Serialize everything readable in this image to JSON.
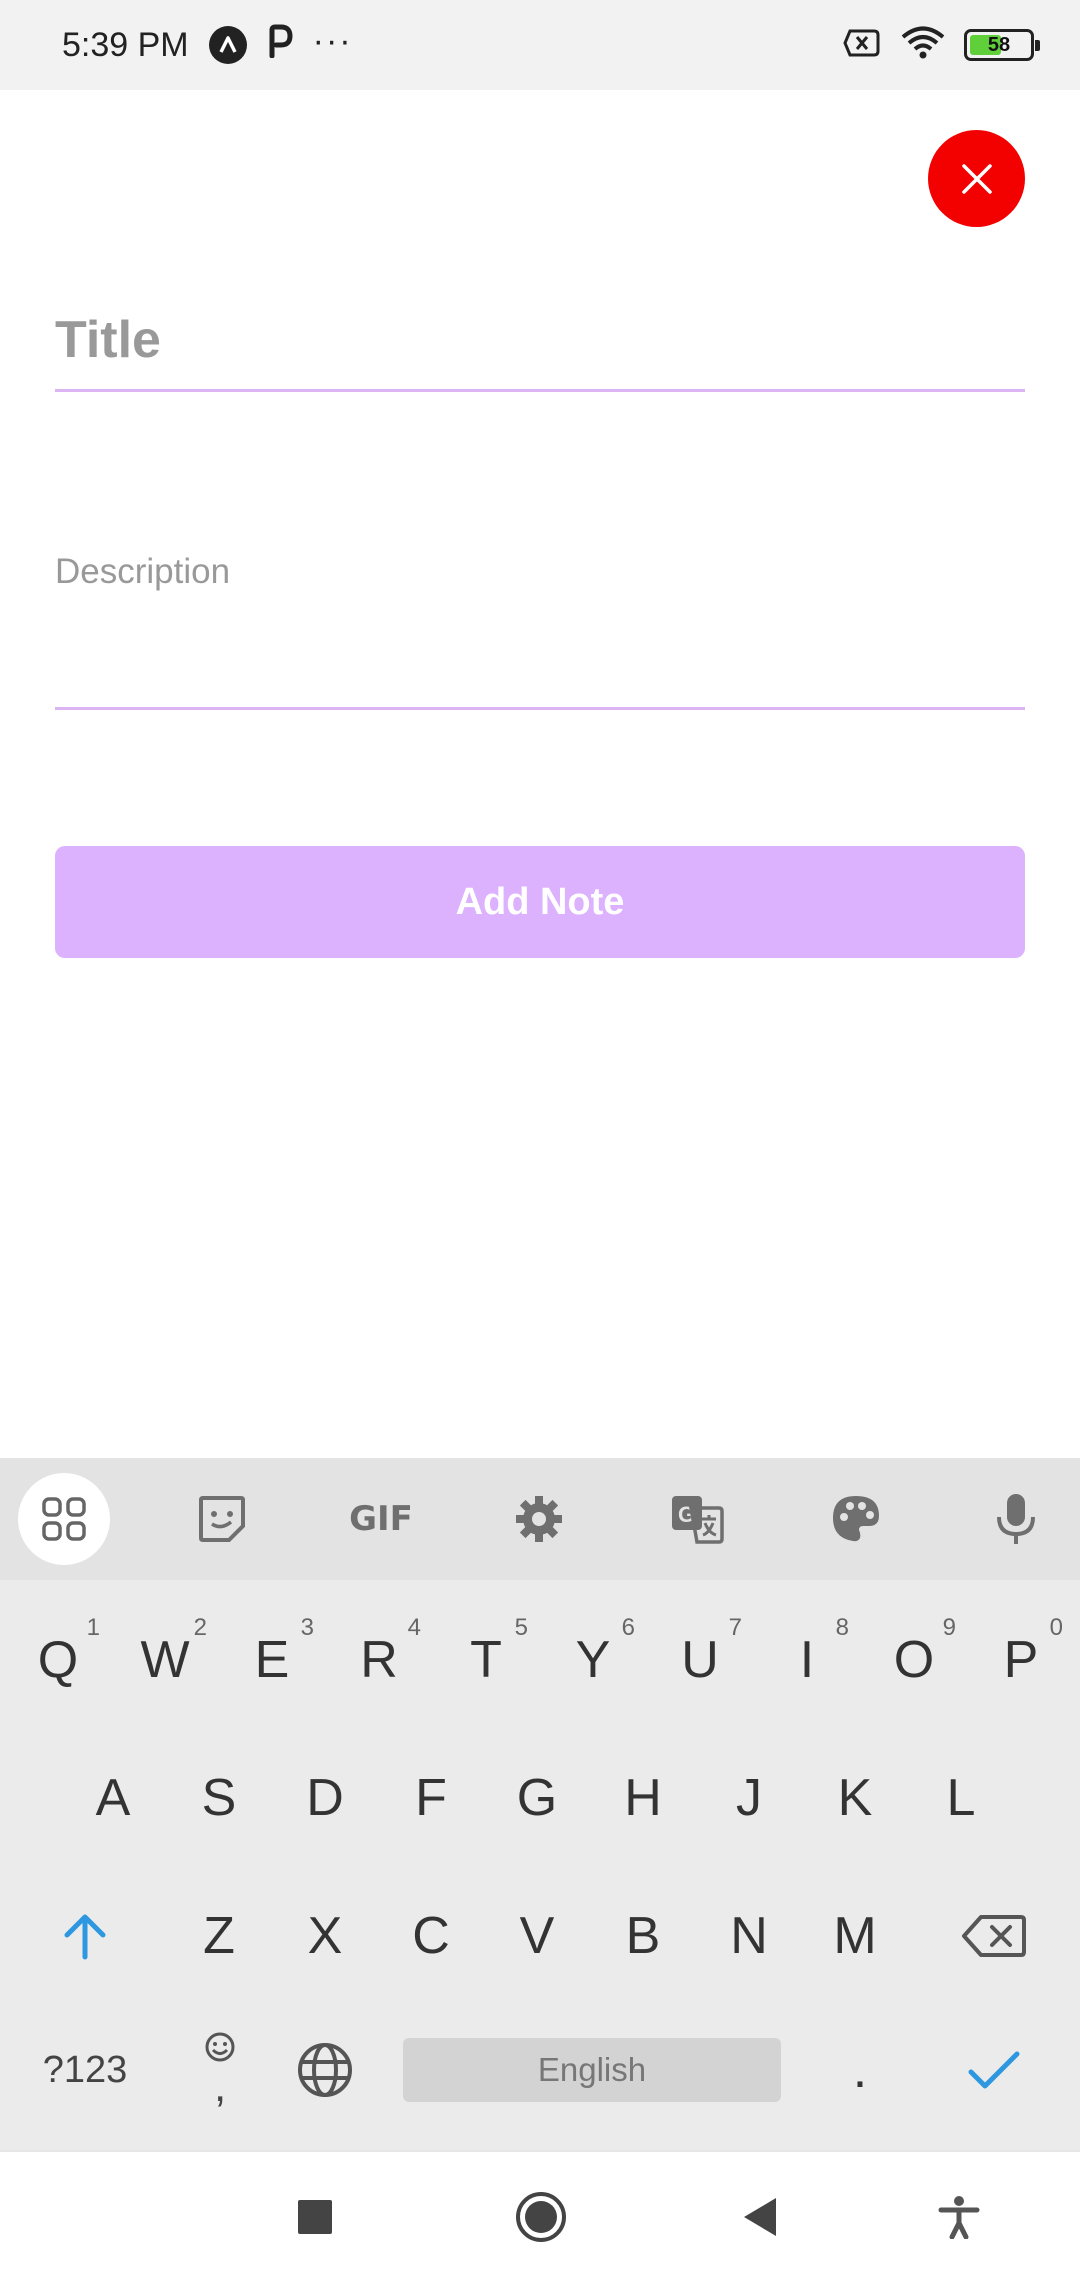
{
  "status_bar": {
    "time": "5:39 PM",
    "battery_level": "58",
    "battery_fraction": 0.58,
    "icons": [
      "a-circle-icon",
      "p-icon",
      "more-dots-icon",
      "sim-off-icon",
      "wifi-icon",
      "battery-icon"
    ]
  },
  "form": {
    "close_icon": "close-icon",
    "title_placeholder": "Title",
    "description_placeholder": "Description",
    "add_button_label": "Add Note"
  },
  "colors": {
    "close_button": "#f30000",
    "field_underline": "#dcb3f3",
    "add_button": "#dcb1fd",
    "placeholder": "#999999"
  },
  "keyboard": {
    "toolbar": [
      "apps-grid-icon",
      "sticker-icon",
      "GIF",
      "settings-icon",
      "translate-icon",
      "palette-icon",
      "mic-icon"
    ],
    "row1": [
      {
        "key": "Q",
        "hint": "1"
      },
      {
        "key": "W",
        "hint": "2"
      },
      {
        "key": "E",
        "hint": "3"
      },
      {
        "key": "R",
        "hint": "4"
      },
      {
        "key": "T",
        "hint": "5"
      },
      {
        "key": "Y",
        "hint": "6"
      },
      {
        "key": "U",
        "hint": "7"
      },
      {
        "key": "I",
        "hint": "8"
      },
      {
        "key": "O",
        "hint": "9"
      },
      {
        "key": "P",
        "hint": "0"
      }
    ],
    "row2": [
      "A",
      "S",
      "D",
      "F",
      "G",
      "H",
      "J",
      "K",
      "L"
    ],
    "row3": [
      "Z",
      "X",
      "C",
      "V",
      "B",
      "N",
      "M"
    ],
    "symbols_key": "?123",
    "emoji_comma_key": ",",
    "space_label": "English",
    "period_key": "."
  },
  "nav_bar": {
    "icons": [
      "recents-square-icon",
      "home-circle-icon",
      "back-triangle-icon",
      "accessibility-icon"
    ]
  }
}
